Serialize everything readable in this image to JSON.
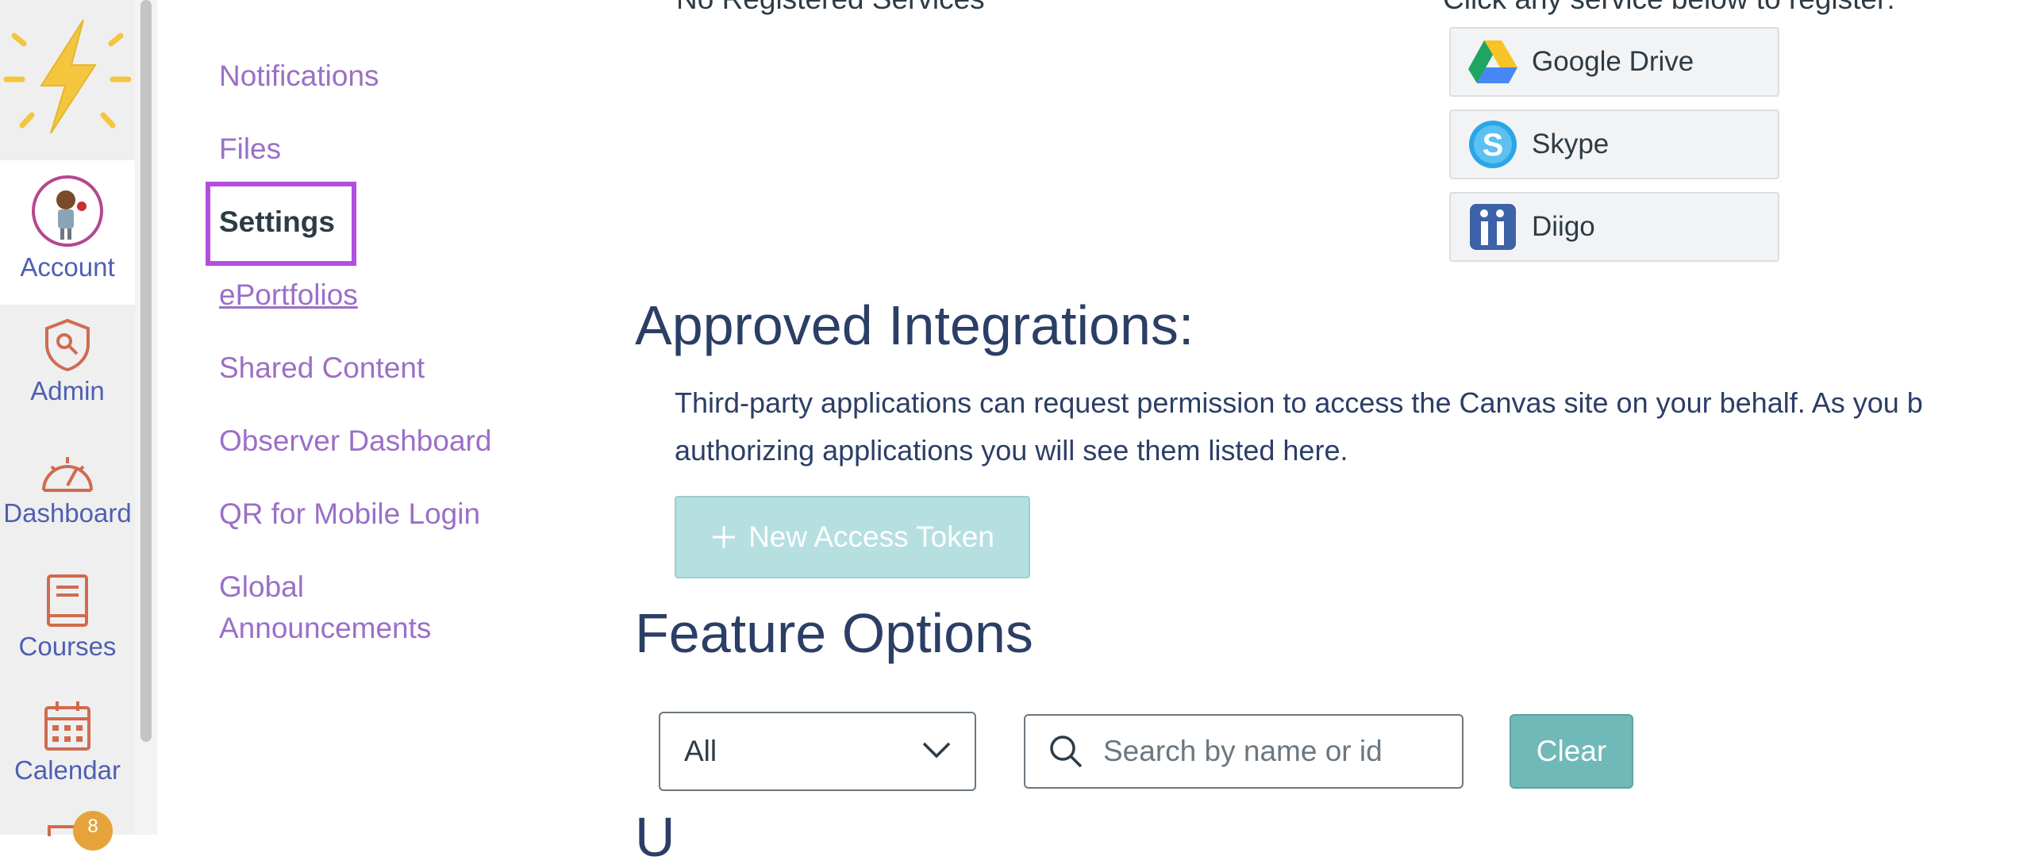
{
  "global_nav": {
    "items": [
      {
        "label": "Account",
        "icon": "avatar"
      },
      {
        "label": "Admin",
        "icon": "admin-icon"
      },
      {
        "label": "Dashboard",
        "icon": "dashboard-icon"
      },
      {
        "label": "Courses",
        "icon": "courses-icon"
      },
      {
        "label": "Calendar",
        "icon": "calendar-icon"
      }
    ],
    "inbox_badge": "8"
  },
  "subnav": {
    "items": [
      "Notifications",
      "Files",
      "Settings",
      "ePortfolios",
      "Shared Content",
      "Observer Dashboard",
      "QR for Mobile Login",
      "Global Announcements"
    ],
    "global_announcements_line1": "Global",
    "global_announcements_line2": "Announcements"
  },
  "services": {
    "none_text": "No Registered Services",
    "register_prompt": "Click any service below to register:",
    "buttons": [
      "Google Drive",
      "Skype",
      "Diigo"
    ]
  },
  "approved_integrations": {
    "heading": "Approved Integrations:",
    "description_line1": "Third-party applications can request permission to access the Canvas site on your behalf. As you b",
    "description_line2": "authorizing applications you will see them listed here.",
    "new_token_label": "New Access Token"
  },
  "feature_options": {
    "heading": "Feature Options",
    "filter_value": "All",
    "search_placeholder": "Search by name or id",
    "clear_label": "Clear",
    "next_heading_partial": "U"
  },
  "colors": {
    "nav_text": "#4f5fb2",
    "nav_icon": "#d06b4f",
    "link": "#9b6fc7",
    "heading": "#2b3e66",
    "highlight": "#b44ee0",
    "clear_button": "#71b8b8"
  }
}
